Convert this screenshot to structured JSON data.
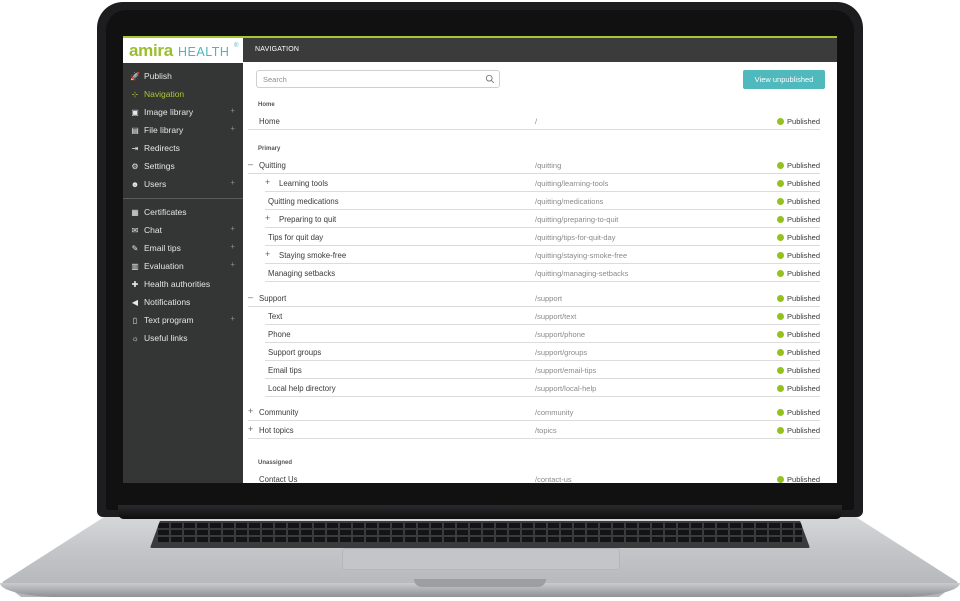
{
  "brand": {
    "name_primary": "amira",
    "name_secondary": "HEALTH",
    "registered": "®"
  },
  "colors": {
    "accent": "#a8c634",
    "button": "#4fb9bd",
    "status_dot": "#95c11f",
    "sidebar_bg": "#343535"
  },
  "sidebar": {
    "items": [
      {
        "label": "Publish",
        "icon": "rocket-icon",
        "glyph": "🚀",
        "plus": ""
      },
      {
        "label": "Navigation",
        "icon": "sitemap-icon",
        "glyph": "⊹",
        "plus": "",
        "active": true
      },
      {
        "label": "Image library",
        "icon": "images-icon",
        "glyph": "▣",
        "plus": "+"
      },
      {
        "label": "File library",
        "icon": "file-icon",
        "glyph": "▤",
        "plus": "+"
      },
      {
        "label": "Redirects",
        "icon": "signpost-icon",
        "glyph": "⇥",
        "plus": ""
      },
      {
        "label": "Settings",
        "icon": "gears-icon",
        "glyph": "⚙",
        "plus": ""
      },
      {
        "label": "Users",
        "icon": "users-icon",
        "glyph": "☻",
        "plus": "+"
      },
      {
        "label": "Certificates",
        "icon": "certificate-icon",
        "glyph": "▦",
        "plus": ""
      },
      {
        "label": "Chat",
        "icon": "chat-icon",
        "glyph": "✉",
        "plus": "+"
      },
      {
        "label": "Email tips",
        "icon": "email-icon",
        "glyph": "✎",
        "plus": "+"
      },
      {
        "label": "Evaluation",
        "icon": "chart-icon",
        "glyph": "▥",
        "plus": "+"
      },
      {
        "label": "Health authorities",
        "icon": "health-icon",
        "glyph": "✚",
        "plus": ""
      },
      {
        "label": "Notifications",
        "icon": "megaphone-icon",
        "glyph": "◀",
        "plus": ""
      },
      {
        "label": "Text program",
        "icon": "mobile-icon",
        "glyph": "▯",
        "plus": "+"
      },
      {
        "label": "Useful links",
        "icon": "lightbulb-icon",
        "glyph": "☼",
        "plus": ""
      }
    ]
  },
  "header": {
    "title": "NAVIGATION"
  },
  "search": {
    "placeholder": "Search"
  },
  "toolbar": {
    "view_unpublished_label": "View unpublished"
  },
  "sections": [
    {
      "label": "Home",
      "rows": [
        {
          "title": "Home",
          "path": "/",
          "status": "Published",
          "expander": "",
          "level": 0
        }
      ]
    },
    {
      "label": "Primary",
      "rows": [
        {
          "title": "Quitting",
          "path": "/quitting",
          "status": "Published",
          "expander": "–",
          "level": 0
        },
        {
          "title": "Learning tools",
          "path": "/quitting/learning-tools",
          "status": "Published",
          "expander": "+",
          "level": 1
        },
        {
          "title": "Quitting medications",
          "path": "/quitting/medications",
          "status": "Published",
          "expander": "",
          "level": 1
        },
        {
          "title": "Preparing to quit",
          "path": "/quitting/preparing-to-quit",
          "status": "Published",
          "expander": "+",
          "level": 1
        },
        {
          "title": "Tips for quit day",
          "path": "/quitting/tips-for-quit-day",
          "status": "Published",
          "expander": "",
          "level": 1
        },
        {
          "title": "Staying smoke-free",
          "path": "/quitting/staying-smoke-free",
          "status": "Published",
          "expander": "+",
          "level": 1
        },
        {
          "title": "Managing setbacks",
          "path": "/quitting/managing-setbacks",
          "status": "Published",
          "expander": "",
          "level": 1
        },
        {
          "title": "Support",
          "path": "/support",
          "status": "Published",
          "expander": "–",
          "level": 0
        },
        {
          "title": "Text",
          "path": "/support/text",
          "status": "Published",
          "expander": "",
          "level": 1
        },
        {
          "title": "Phone",
          "path": "/support/phone",
          "status": "Published",
          "expander": "",
          "level": 1
        },
        {
          "title": "Support groups",
          "path": "/support/groups",
          "status": "Published",
          "expander": "",
          "level": 1
        },
        {
          "title": "Email tips",
          "path": "/support/email-tips",
          "status": "Published",
          "expander": "",
          "level": 1
        },
        {
          "title": "Local help directory",
          "path": "/support/local-help",
          "status": "Published",
          "expander": "",
          "level": 1
        },
        {
          "title": "Community",
          "path": "/community",
          "status": "Published",
          "expander": "+",
          "level": 0
        },
        {
          "title": "Hot topics",
          "path": "/topics",
          "status": "Published",
          "expander": "+",
          "level": 0
        }
      ]
    },
    {
      "label": "Unassigned",
      "rows": [
        {
          "title": "Contact Us",
          "path": "/contact-us",
          "status": "Published",
          "expander": "",
          "level": 0
        }
      ]
    }
  ]
}
